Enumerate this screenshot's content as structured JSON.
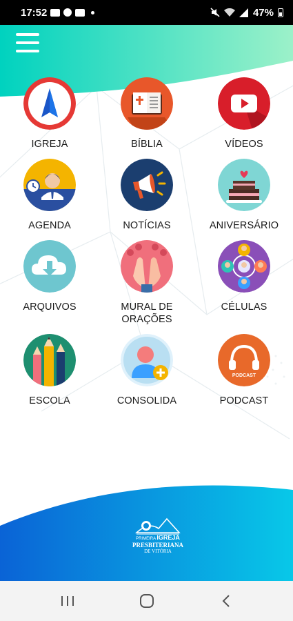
{
  "status_bar": {
    "time": "17:52",
    "battery": "47%",
    "left_icons": [
      "youtube-icon",
      "whatsapp-icon",
      "gallery-icon"
    ],
    "right_icons": [
      "mute-icon",
      "wifi-icon",
      "signal-icon",
      "battery-icon"
    ]
  },
  "header": {
    "menu_icon": "hamburger-menu-icon",
    "gradient": [
      "#00d4c0",
      "#8ef0c8"
    ]
  },
  "menu_items": [
    {
      "label": "IGREJA",
      "icon": "navigation-arrow-icon",
      "color": "#e53935"
    },
    {
      "label": "BÍBLIA",
      "icon": "bible-book-icon",
      "color": "#e8572a"
    },
    {
      "label": "VÍDEOS",
      "icon": "youtube-play-icon",
      "color": "#d81e2a"
    },
    {
      "label": "AGENDA",
      "icon": "agenda-person-clock-icon",
      "color": "#f4b400"
    },
    {
      "label": "NOTÍCIAS",
      "icon": "megaphone-icon",
      "color": "#1b3e6f"
    },
    {
      "label": "ANIVERSÁRIO",
      "icon": "birthday-cake-icon",
      "color": "#7fd6d4"
    },
    {
      "label": "ARQUIVOS",
      "icon": "cloud-download-icon",
      "color": "#6ec6cf"
    },
    {
      "label": "MURAL DE\nORAÇÕES",
      "icon": "praying-hands-icon",
      "color": "#f06f7c"
    },
    {
      "label": "CÉLULAS",
      "icon": "people-network-icon",
      "color": "#8a4fb8"
    },
    {
      "label": "ESCOLA",
      "icon": "pencils-icon",
      "color": "#1e8f70"
    },
    {
      "label": "CONSOLIDA",
      "icon": "add-user-icon",
      "color": "#b9dff2"
    },
    {
      "label": "PODCAST",
      "icon": "headphones-podcast-icon",
      "color": "#e8692a",
      "badge": "PODCAST"
    }
  ],
  "logo": {
    "line1_small": "PRIMEIRA",
    "line1_big": "IGREJA",
    "line2": "PRESBITERIANA",
    "line3": "DE VITÓRIA"
  },
  "footer": {
    "gradient": [
      "#0b6fd8",
      "#08c4e6"
    ]
  },
  "nav_bar": {
    "buttons": [
      "recent-apps-icon",
      "home-icon",
      "back-icon"
    ]
  }
}
